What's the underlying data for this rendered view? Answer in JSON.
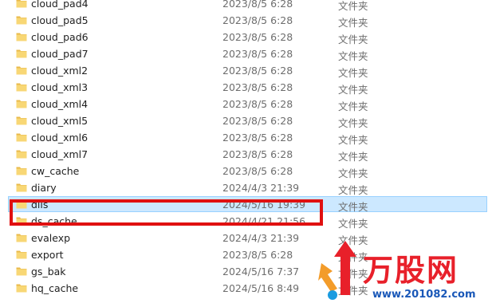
{
  "files": [
    {
      "name": "cloud_pad4",
      "date": "2023/8/5 6:28",
      "type": "文件夹"
    },
    {
      "name": "cloud_pad5",
      "date": "2023/8/5 6:28",
      "type": "文件夹"
    },
    {
      "name": "cloud_pad6",
      "date": "2023/8/5 6:28",
      "type": "文件夹"
    },
    {
      "name": "cloud_pad7",
      "date": "2023/8/5 6:28",
      "type": "文件夹"
    },
    {
      "name": "cloud_xml2",
      "date": "2023/8/5 6:28",
      "type": "文件夹"
    },
    {
      "name": "cloud_xml3",
      "date": "2023/8/5 6:28",
      "type": "文件夹"
    },
    {
      "name": "cloud_xml4",
      "date": "2023/8/5 6:28",
      "type": "文件夹"
    },
    {
      "name": "cloud_xml5",
      "date": "2023/8/5 6:28",
      "type": "文件夹"
    },
    {
      "name": "cloud_xml6",
      "date": "2023/8/5 6:28",
      "type": "文件夹"
    },
    {
      "name": "cloud_xml7",
      "date": "2023/8/5 6:28",
      "type": "文件夹"
    },
    {
      "name": "cw_cache",
      "date": "2023/8/5 6:28",
      "type": "文件夹"
    },
    {
      "name": "diary",
      "date": "2024/4/3 21:39",
      "type": "文件夹"
    },
    {
      "name": "dlls",
      "date": "2024/5/16 19:39",
      "type": "文件夹",
      "selected": true
    },
    {
      "name": "ds_cache",
      "date": "2024/4/21 21:56",
      "type": "文件夹"
    },
    {
      "name": "evalexp",
      "date": "2024/4/3 21:39",
      "type": "文件夹"
    },
    {
      "name": "export",
      "date": "2023/8/5 6:28",
      "type": "文件夹"
    },
    {
      "name": "gs_bak",
      "date": "2024/5/16 7:37",
      "type": "文件夹"
    },
    {
      "name": "hq_cache",
      "date": "2024/5/16 8:49",
      "type": "文件夹"
    }
  ],
  "icons": {
    "folder": "folder-icon"
  },
  "colors": {
    "folder": "#f8d775",
    "selection_bg": "#cce8ff",
    "highlight_border": "#e01010",
    "logo_red": "#e8202a",
    "logo_blue": "#1a58b8"
  },
  "watermark": {
    "logo_text": "万股网",
    "url": "www.201082.com"
  }
}
